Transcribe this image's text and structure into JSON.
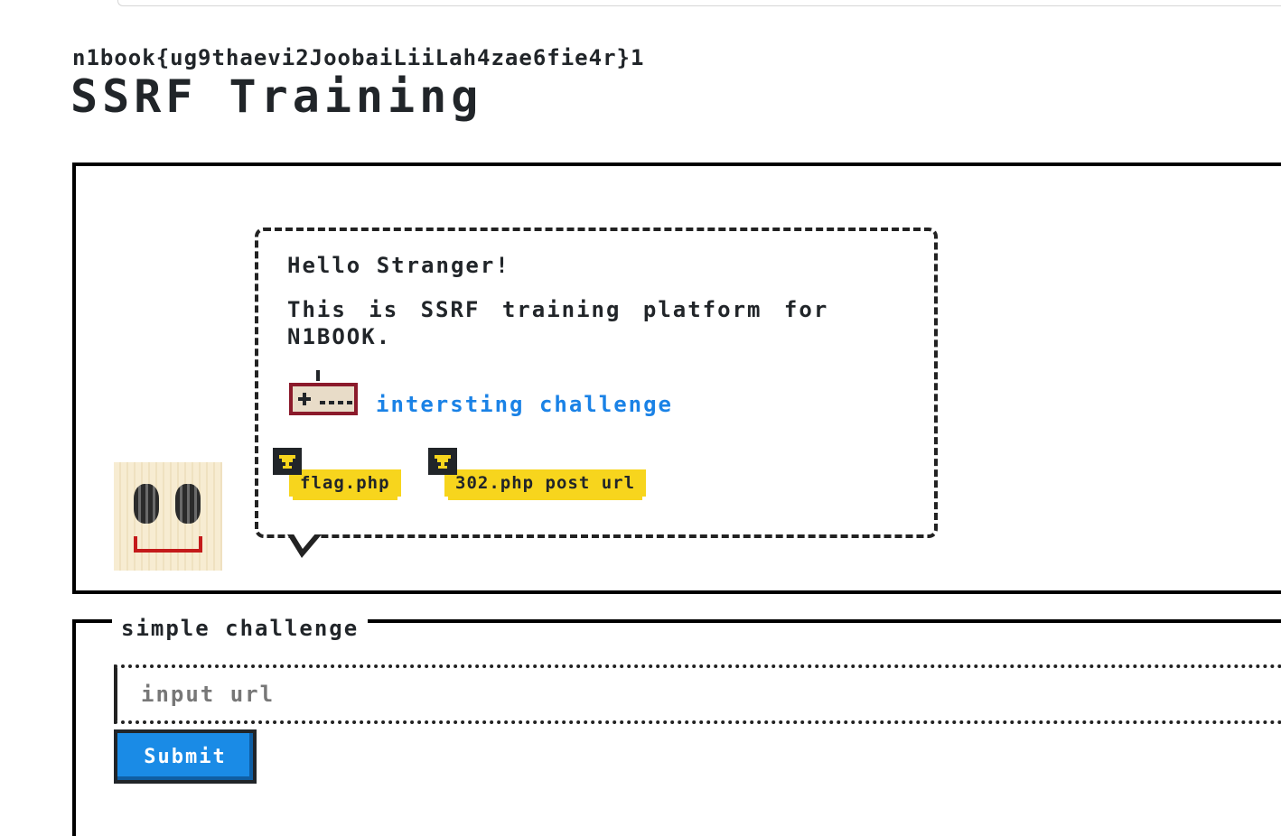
{
  "header": {
    "flag": "n1book{ug9thaevi2JoobaiLiiLah4zae6fie4r}1",
    "title": "SSRF Training"
  },
  "bubble": {
    "greeting": "Hello Stranger!",
    "intro": "This is SSRF training platform for N1BOOK.",
    "challenge_link": "intersting challenge",
    "badges": [
      {
        "label": "flag.php",
        "icon": "trophy-icon"
      },
      {
        "label": "302.php post url",
        "icon": "trophy-icon"
      }
    ]
  },
  "form": {
    "legend": "simple challenge",
    "input_placeholder": "input url",
    "input_value": "",
    "submit_label": "Submit"
  },
  "colors": {
    "link": "#1a82e6",
    "badge": "#f7d51d",
    "submit": "#1a8be6",
    "mouth": "#c41a1a",
    "gamepad": "#8b1a2b"
  }
}
